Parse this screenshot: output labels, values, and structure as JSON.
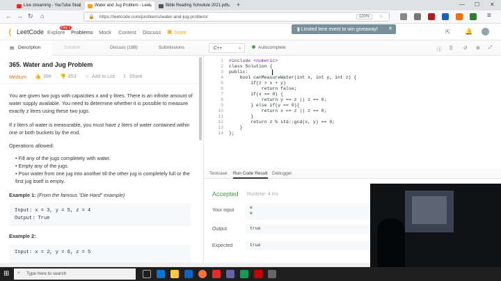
{
  "browser": {
    "tabs": [
      {
        "label": "Live streaming - YouTube Stud",
        "color": "#e52d27"
      },
      {
        "label": "Water and Jug Problem - Leet",
        "color": "#ffa116"
      },
      {
        "label": "Bible Reading Schedule 2021.pdf",
        "color": "#555555"
      }
    ],
    "url": "https://leetcode.com/problems/water-and-jug-problem/",
    "zoom": "120%"
  },
  "lc": {
    "brand": "LeetCode",
    "nav": [
      "Explore",
      "Problems",
      "Mock",
      "Contest",
      "Discuss",
      "Store"
    ],
    "badge": "Day 1",
    "banner": "Limited time event to win giveaway!"
  },
  "panel_tabs": [
    "Description",
    "Solution",
    "Discuss (188)",
    "Submissions"
  ],
  "editor_bar": {
    "language": "C++",
    "autocomplete": "Autocomplete"
  },
  "problem": {
    "title": "365. Water and Jug Problem",
    "difficulty": "Medium",
    "likes": "398",
    "dislikes": "853",
    "add_to_list": "Add to List",
    "share": "Share",
    "p1": "You are given two jugs with capacities x and y litres. There is an infinite amount of water supply available. You need to determine whether it is possible to measure exactly z litres using these two jugs.",
    "p2": "If z liters of water is measurable, you must have z liters of water contained within one or both buckets by the end.",
    "ops_heading": "Operations allowed:",
    "ops": [
      "Fill any of the jugs completely with water.",
      "Empty any of the jugs.",
      "Pour water from one jug into another till the other jug is completely full or the first jug itself is empty."
    ],
    "ex1_heading": "Example 1:",
    "ex1_note": "(From the famous \"Die Hard\" example)",
    "ex1_input": "Input: x = 3, y = 5, z = 4",
    "ex1_output": "Output: True",
    "ex2_heading": "Example 2:",
    "ex2_input": "Input: x = 2, y = 6, z = 5"
  },
  "code_lines": [
    "#include <numeric>",
    "class Solution {",
    "public:",
    "    bool canMeasureWater(int x, int y, int z) {",
    "        if(z > x + y)",
    "            return false;",
    "        if(x == 0) {",
    "            return y == z || z == 0;",
    "        } else if(y == 0){",
    "            return x == z || z == 0;",
    "        }",
    "        return z % std::gcd(x, y) == 0;",
    "    }",
    "};"
  ],
  "result": {
    "tabs": [
      "Testcase",
      "Run Code Result",
      "Debugger"
    ],
    "status": "Accepted",
    "runtime": "Runtime: 4 ms",
    "input_label": "Your input",
    "input_lines": [
      "e",
      "e"
    ],
    "output_label": "Output",
    "output": "true",
    "expected_label": "Expected",
    "expected": "true"
  },
  "taskbar": {
    "search_placeholder": "Type here to search"
  }
}
